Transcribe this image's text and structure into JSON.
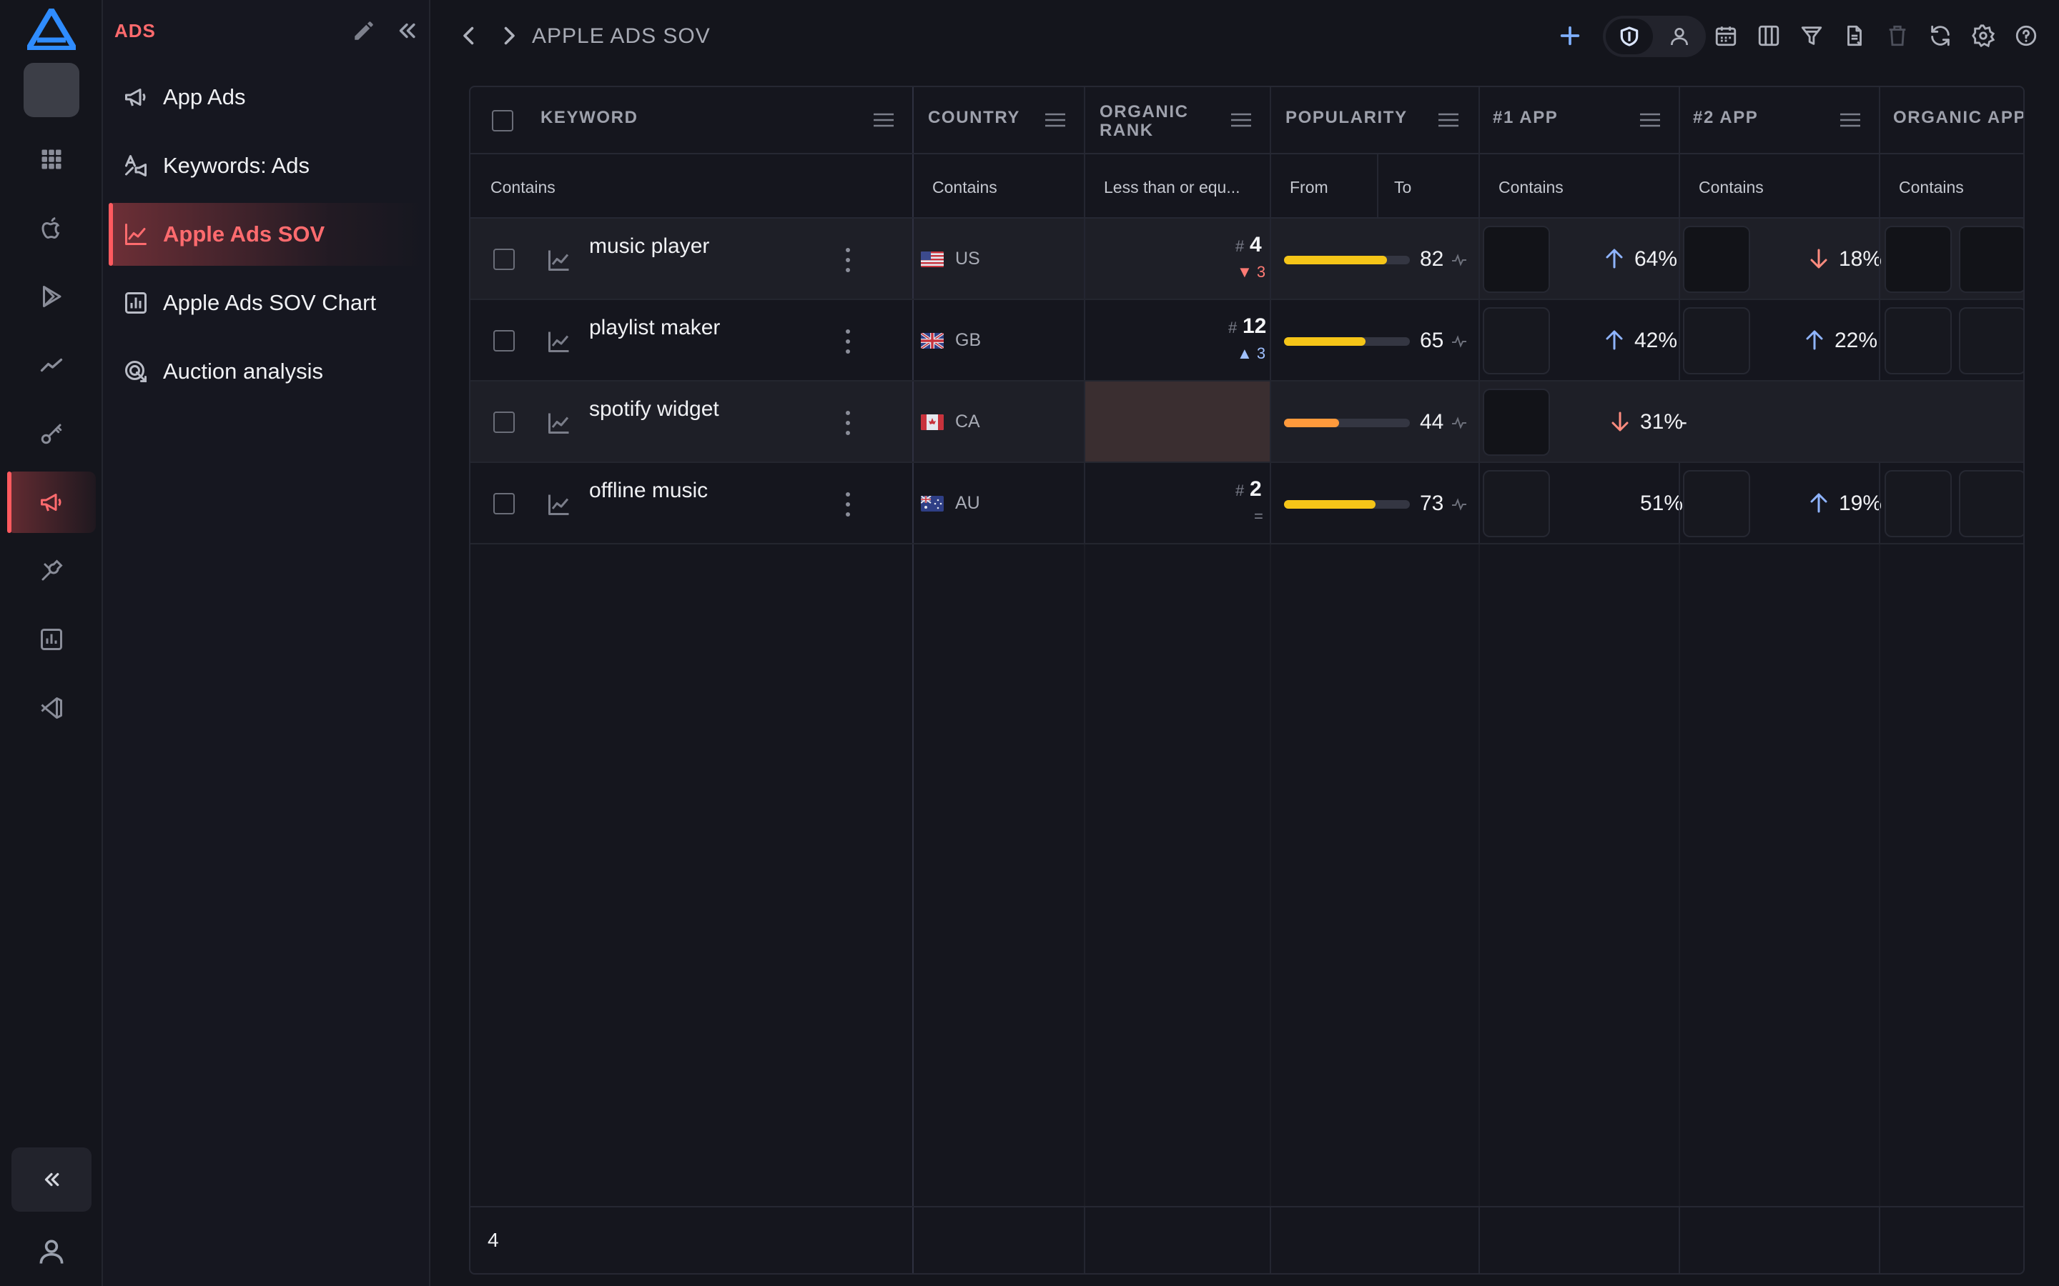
{
  "app": {
    "accent": "#ff5a5f",
    "logo": "app-logo"
  },
  "rail": {
    "items": [
      {
        "name": "apps-grid-icon"
      },
      {
        "name": "apple-icon"
      },
      {
        "name": "play-store-icon"
      },
      {
        "name": "trend-icon"
      },
      {
        "name": "key-icon"
      },
      {
        "name": "megaphone-icon",
        "active": true
      },
      {
        "name": "tools-icon"
      },
      {
        "name": "bar-chart-icon"
      },
      {
        "name": "vscode-icon"
      }
    ],
    "collapse_icon": "double-chevron-left-icon",
    "user_icon": "user-icon"
  },
  "sidebar": {
    "title": "ADS",
    "items": [
      {
        "label": "App Ads",
        "icon": "megaphone-icon"
      },
      {
        "label": "Keywords: Ads",
        "icon": "keyword-ads-icon"
      },
      {
        "label": "Apple Ads SOV",
        "icon": "line-chart-icon",
        "active": true
      },
      {
        "label": "Apple Ads SOV Chart",
        "icon": "bar-chart-icon"
      },
      {
        "label": "Auction analysis",
        "icon": "auction-icon"
      }
    ]
  },
  "topbar": {
    "title": "APPLE ADS SOV",
    "icons": [
      "add-icon",
      "shield-icon",
      "user-icon",
      "calendar-icon",
      "columns-icon",
      "filter-icon",
      "export-icon",
      "trash-icon",
      "refresh-icon",
      "settings-icon",
      "help-icon"
    ]
  },
  "table": {
    "columns": {
      "keyword": "KEYWORD",
      "country": "COUNTRY",
      "organic_rank": "ORGANIC RANK",
      "popularity": "POPULARITY",
      "app1": "#1 APP",
      "app2": "#2 APP",
      "organic_apps": "ORGANIC APPS"
    },
    "filters": {
      "keyword": "Contains",
      "country": "Contains",
      "organic_rank": "Less than or equ...",
      "popularity_from": "From",
      "popularity_to": "To",
      "app1": "Contains",
      "app2": "Contains",
      "organic_apps": "Contains"
    },
    "rows": [
      {
        "keyword": "music player",
        "country": "US",
        "flag": "us-flag",
        "rank_hash": "#",
        "rank": "4",
        "rank_delta": "3",
        "rank_dir": "down",
        "popularity": "82",
        "popularity_fraction": 0.82,
        "popularity_color": "#f5c518",
        "app1_pct": "64%",
        "app1_dir": "up",
        "app2_pct": "18%",
        "app2_dir": "down"
      },
      {
        "keyword": "playlist maker",
        "country": "GB",
        "flag": "gb-flag",
        "rank_hash": "#",
        "rank": "12",
        "rank_delta": "3",
        "rank_dir": "up",
        "popularity": "65",
        "popularity_fraction": 0.65,
        "popularity_color": "#f5c518",
        "app1_pct": "42%",
        "app1_dir": "up",
        "app2_pct": "22%",
        "app2_dir": "up"
      },
      {
        "keyword": "spotify widget",
        "country": "CA",
        "flag": "ca-flag",
        "rank_hash": "",
        "rank": "",
        "rank_delta": "",
        "rank_dir": "none",
        "popularity": "44",
        "popularity_fraction": 0.44,
        "popularity_color": "#ff9a3c",
        "app1_pct": "31%",
        "app1_dir": "down",
        "app2_pct": "-",
        "app2_dir": "none"
      },
      {
        "keyword": "offline music",
        "country": "AU",
        "flag": "au-flag",
        "rank_hash": "#",
        "rank": "2",
        "rank_delta": "=",
        "rank_dir": "same",
        "popularity": "73",
        "popularity_fraction": 0.73,
        "popularity_color": "#f5c518",
        "app1_pct": "51%",
        "app1_dir": "none",
        "app2_pct": "19%",
        "app2_dir": "up"
      }
    ],
    "footer_count": "4"
  }
}
